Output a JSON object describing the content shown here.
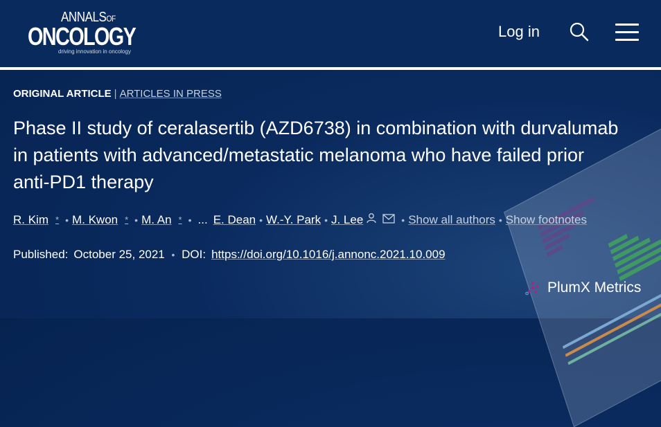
{
  "header": {
    "logo": {
      "line1": "ANNALS",
      "of": "OF",
      "line2": "ONCOLOGY",
      "tagline": "driving innovation in oncology"
    },
    "login_label": "Log in",
    "search_icon": "search-icon",
    "menu_icon": "hamburger-menu-icon"
  },
  "article": {
    "type": "ORIGINAL ARTICLE",
    "separator": "|",
    "section": "ARTICLES IN PRESS",
    "title": "Phase II study of ceralasertib (AZD6738) in combination with durvalumab in patients with advanced/metastatic melanoma who have failed prior anti-PD1 therapy",
    "authors": [
      {
        "name": "R. Kim",
        "mark": "*"
      },
      {
        "name": "M. Kwon",
        "mark": "*"
      },
      {
        "name": "M. An",
        "mark": "*"
      }
    ],
    "ellipsis": "...",
    "last_authors": [
      "E. Dean",
      "W.-Y. Park",
      "J. Lee"
    ],
    "show_all_authors": "Show all authors",
    "show_footnotes": "Show footnotes",
    "published_label": "Published:",
    "published_date": "October 25, 2021",
    "doi_label": "DOI:",
    "doi": "https://doi.org/10.1016/j.annonc.2021.10.009"
  },
  "plumx": {
    "label": "PlumX Metrics"
  },
  "colors": {
    "background": "#082a5c",
    "text": "#ffffff",
    "muted": "#c6d2e2",
    "plumx_accent": "#9c2a8c"
  }
}
